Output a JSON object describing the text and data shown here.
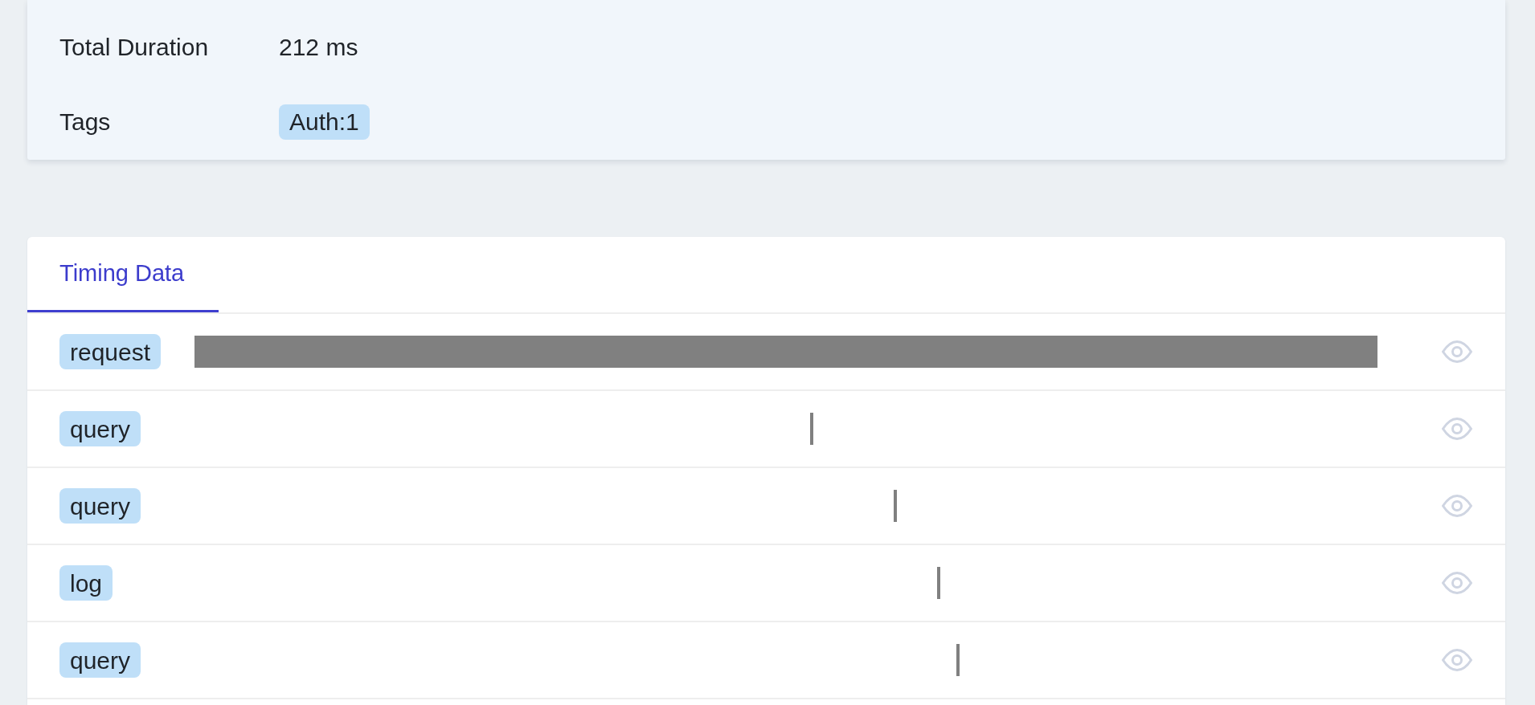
{
  "summary": {
    "rows": [
      {
        "kind": "text",
        "label": "Total Duration",
        "value": "212 ms"
      },
      {
        "kind": "tags",
        "label": "Tags",
        "tags": [
          "Auth:1"
        ]
      }
    ]
  },
  "timing": {
    "tabs": [
      {
        "label": "Timing Data",
        "selected": true
      }
    ],
    "rows": [
      {
        "name": "request"
      },
      {
        "name": "query"
      },
      {
        "name": "query"
      },
      {
        "name": "log"
      },
      {
        "name": "query"
      }
    ]
  }
}
